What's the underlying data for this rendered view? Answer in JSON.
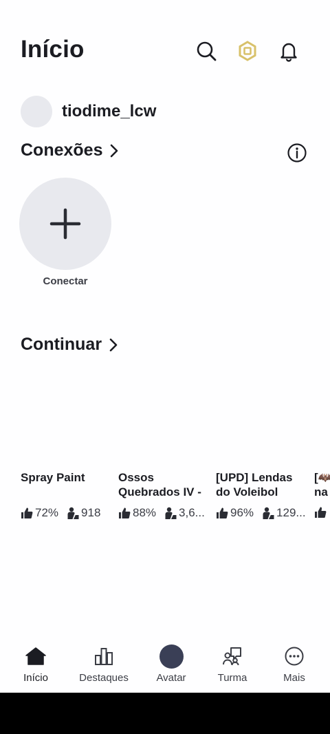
{
  "header": {
    "title": "Início"
  },
  "user": {
    "name": "tiodime_lcw"
  },
  "connections": {
    "title": "Conexões",
    "connect_label": "Conectar"
  },
  "continue": {
    "title": "Continuar"
  },
  "games": [
    {
      "title": "Spray Paint",
      "rating": "72%",
      "players": "918"
    },
    {
      "title": "Ossos Quebrados IV -",
      "rating": "88%",
      "players": "3,6..."
    },
    {
      "title": "[UPD] Lendas do Voleibol",
      "rating": "96%",
      "players": "129..."
    },
    {
      "title": "[🦇 na",
      "rating": "",
      "players": ""
    }
  ],
  "nav": {
    "home": "Início",
    "charts": "Destaques",
    "avatar": "Avatar",
    "party": "Turma",
    "more": "Mais"
  },
  "colors": {
    "background": "#fefeff",
    "text": "#1b1c22",
    "robux": "#d8c16a",
    "avatar": "#3a3f56"
  }
}
